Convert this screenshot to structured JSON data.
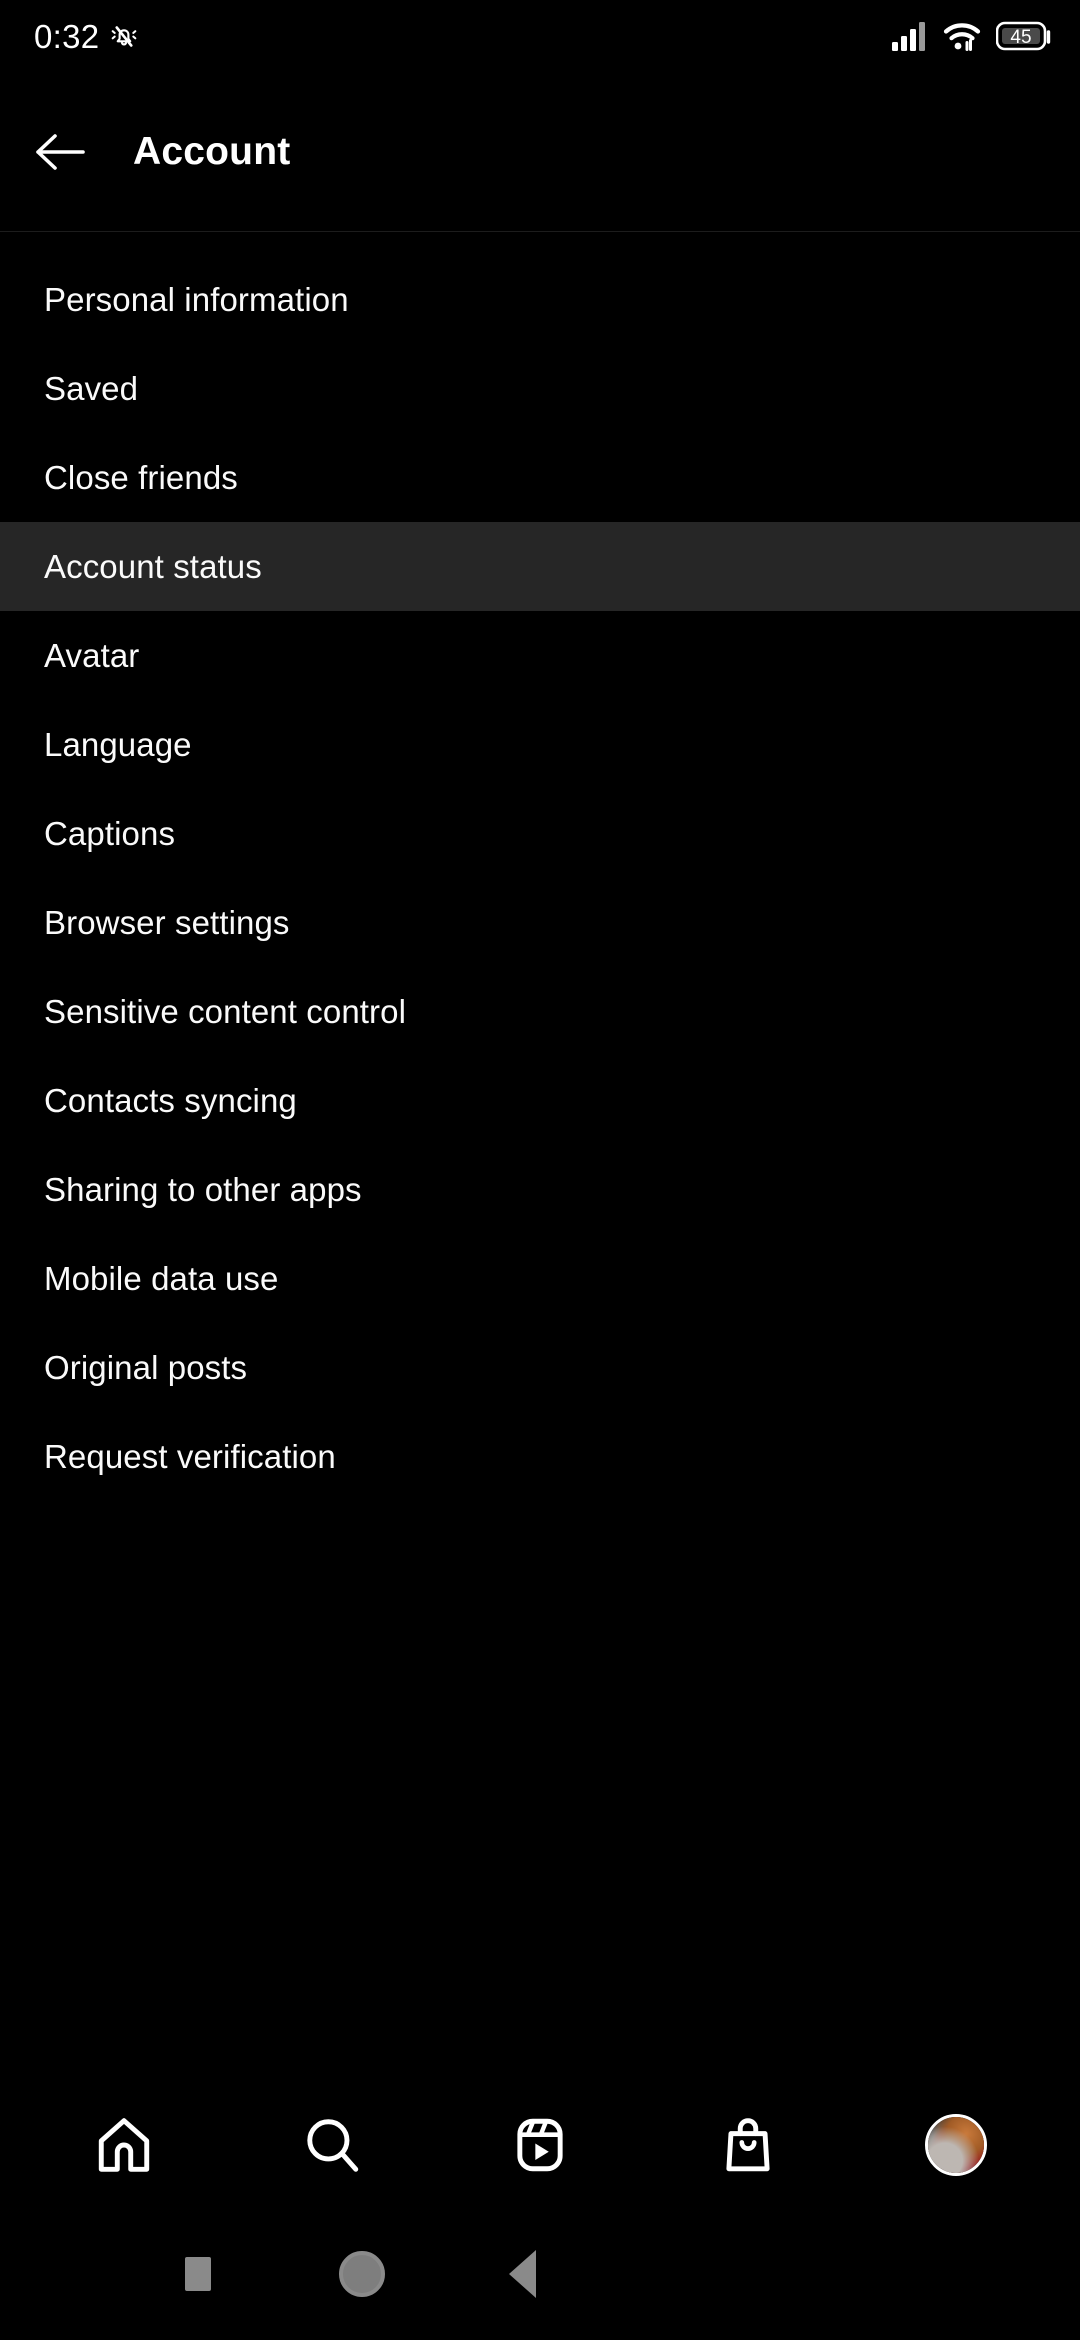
{
  "status_bar": {
    "time": "0:32",
    "icons": [
      "vibrate-silent-icon",
      "cellular-signal-icon",
      "wifi-icon",
      "battery-icon"
    ],
    "battery_level": "45",
    "signal_bars": 4,
    "wifi_bars": 3
  },
  "header": {
    "back_icon": "back-arrow-icon",
    "title": "Account"
  },
  "menu": {
    "items": [
      {
        "label": "Personal information",
        "selected": false
      },
      {
        "label": "Saved",
        "selected": false
      },
      {
        "label": "Close friends",
        "selected": false
      },
      {
        "label": "Account status",
        "selected": true
      },
      {
        "label": "Avatar",
        "selected": false
      },
      {
        "label": "Language",
        "selected": false
      },
      {
        "label": "Captions",
        "selected": false
      },
      {
        "label": "Browser settings",
        "selected": false
      },
      {
        "label": "Sensitive content control",
        "selected": false
      },
      {
        "label": "Contacts syncing",
        "selected": false
      },
      {
        "label": "Sharing to other apps",
        "selected": false
      },
      {
        "label": "Mobile data use",
        "selected": false
      },
      {
        "label": "Original posts",
        "selected": false
      },
      {
        "label": "Request verification",
        "selected": false
      }
    ]
  },
  "tab_bar": {
    "tabs": [
      {
        "name": "home-icon",
        "label": "Home"
      },
      {
        "name": "search-icon",
        "label": "Search"
      },
      {
        "name": "reels-icon",
        "label": "Reels"
      },
      {
        "name": "shop-icon",
        "label": "Shop"
      },
      {
        "name": "profile-avatar",
        "label": "Profile"
      }
    ]
  },
  "system_nav": {
    "buttons": [
      {
        "name": "recents-button",
        "label": "Recents"
      },
      {
        "name": "home-button",
        "label": "Home"
      },
      {
        "name": "back-button",
        "label": "Back"
      }
    ]
  },
  "colors": {
    "background": "#000000",
    "selected_row": "#262626",
    "text": "#fafafa",
    "divider": "#1c1c1c",
    "nav_icon": "#8a8a8a"
  }
}
